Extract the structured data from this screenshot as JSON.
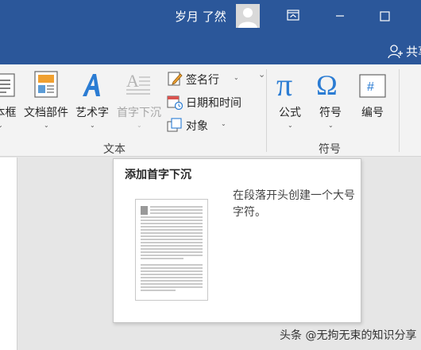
{
  "titlebar": {
    "user_name": "岁月 了然",
    "share_label": "共享",
    "color": "#2b579a"
  },
  "ribbon": {
    "text_group": {
      "label": "文本",
      "items": [
        {
          "label": "文本框",
          "icon": "text-box-icon"
        },
        {
          "label": "文档部件",
          "icon": "quick-parts-icon"
        },
        {
          "label": "艺术字",
          "icon": "wordart-icon"
        },
        {
          "label": "首字下沉",
          "icon": "drop-cap-icon",
          "disabled": true
        }
      ],
      "small_items": [
        {
          "label": "签名行",
          "icon": "signature-line-icon"
        },
        {
          "label": "日期和时间",
          "icon": "date-time-icon"
        },
        {
          "label": "对象",
          "icon": "object-icon"
        }
      ]
    },
    "symbols_group": {
      "label": "符号",
      "items": [
        {
          "label": "公式",
          "icon": "equation-icon",
          "glyph": "π"
        },
        {
          "label": "符号",
          "icon": "symbol-icon",
          "glyph": "Ω"
        },
        {
          "label": "编号",
          "icon": "number-icon",
          "glyph": "#"
        }
      ]
    }
  },
  "tooltip": {
    "title": "添加首字下沉",
    "description": "在段落开头创建一个大号字符。"
  },
  "watermark": "头条 @无拘无束的知识分享"
}
